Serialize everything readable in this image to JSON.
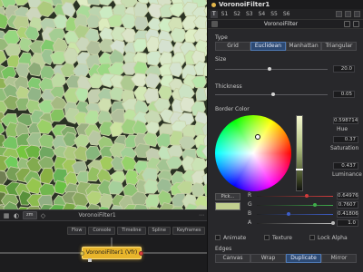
{
  "viewer": {
    "bottom_title": "VoronoiFilter1",
    "icons": [
      "grid-icon",
      "rgb-icon",
      "stereo-icon"
    ],
    "buttons": [
      "zm"
    ]
  },
  "flow": {
    "toolbar": [
      "Flow",
      "Console",
      "Timeline",
      "Spline",
      "Keyframes"
    ],
    "node_label": "VoronoiFilter1 (Vfr)"
  },
  "inspector": {
    "title": "VoronoiFilter1",
    "tabs": [
      "T",
      "S1",
      "S2",
      "S3",
      "S4",
      "S5",
      "S6"
    ],
    "tool_name": "VoronoiFilter",
    "type_label": "Type",
    "type_options": [
      "Grid",
      "Euclidean",
      "Manhattan",
      "Triangular"
    ],
    "type_selected": "Euclidean",
    "size_label": "Size",
    "size_value": "20.0",
    "size_fraction": 0.48,
    "thickness_label": "Thickness",
    "thickness_value": "0.05",
    "thickness_fraction": 0.52,
    "border_color_label": "Border Color",
    "hsv": {
      "hue_label": "Hue",
      "hue_value": "0.598714",
      "sat_label": "Saturation",
      "sat_value": "0.37",
      "lum_label": "Luminance",
      "lum_value": "0.437"
    },
    "pick_label": "Pick...",
    "swatch_color": "#c1cf8f",
    "channels": [
      {
        "name": "R",
        "value": "0.64976",
        "fraction": 0.65,
        "color": "#d23b3b"
      },
      {
        "name": "G",
        "value": "0.7607",
        "fraction": 0.76,
        "color": "#3fae4b"
      },
      {
        "name": "B",
        "value": "0.41806",
        "fraction": 0.42,
        "color": "#3d5ec9"
      },
      {
        "name": "A",
        "value": "1.0",
        "fraction": 1.0,
        "color": "#bbbbbb"
      }
    ],
    "checkboxes": [
      {
        "label": "Animate",
        "checked": false
      },
      {
        "label": "Texture",
        "checked": false
      },
      {
        "label": "Lock Alpha",
        "checked": false
      }
    ],
    "edges_label": "Edges",
    "edge_options": [
      "Canvas",
      "Wrap",
      "Duplicate",
      "Mirror"
    ],
    "edge_selected": "Duplicate"
  },
  "colors": {
    "accent": "#4f79b3",
    "node": "#e8b52b",
    "panel": "#28282b"
  }
}
